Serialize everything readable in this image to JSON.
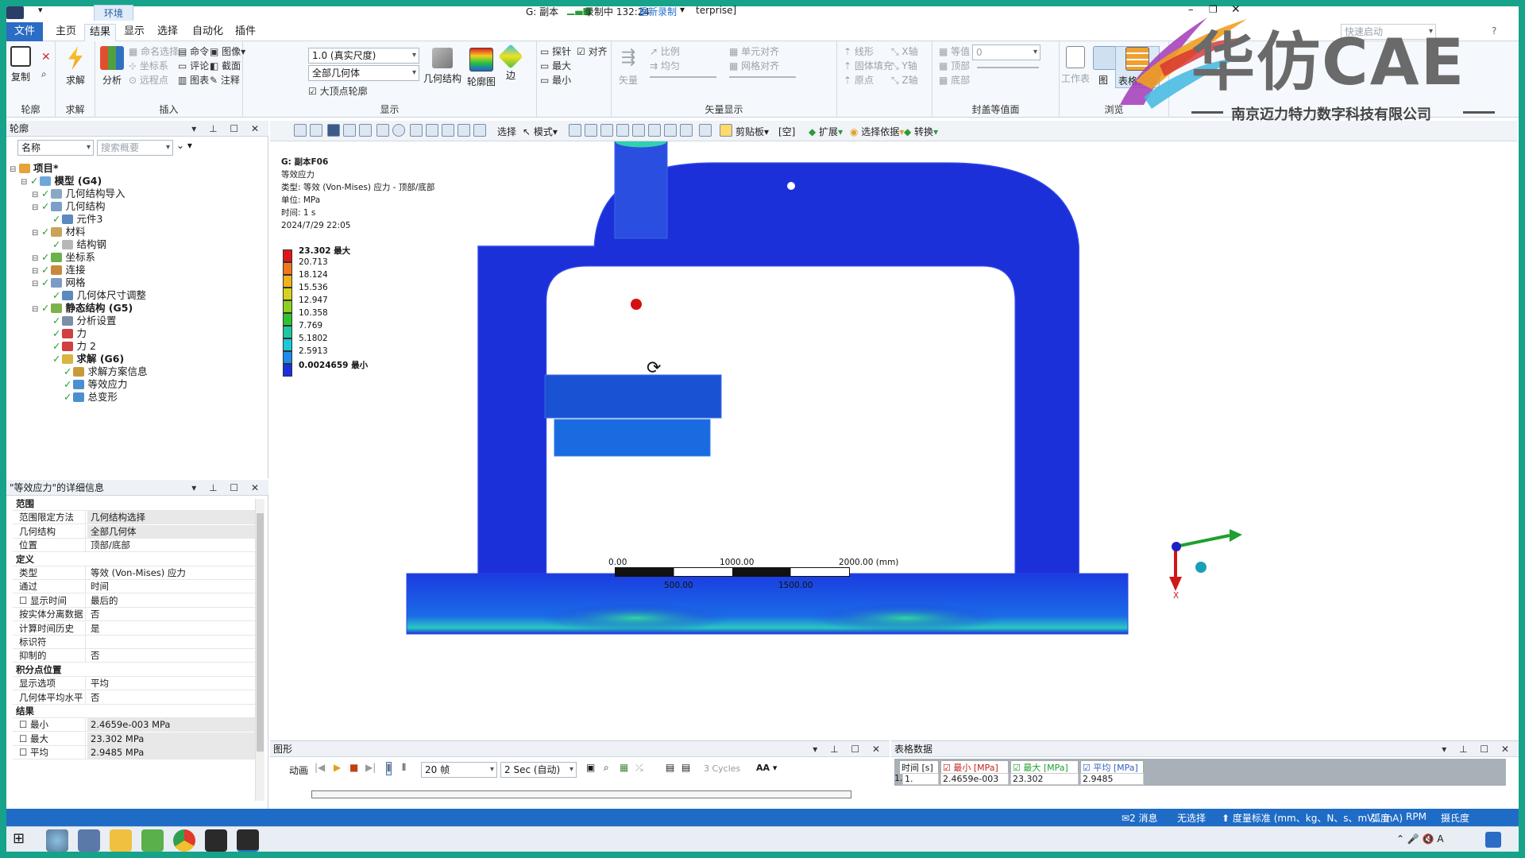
{
  "title": {
    "doc": "G: 副本",
    "recording": "录制中 132:24",
    "rerecord": "重新录制",
    "app_suffix": "terprise]",
    "context_tab": "环境"
  },
  "ribbon_tabs": [
    "文件",
    "主页",
    "结果",
    "显示",
    "选择",
    "自动化",
    "插件"
  ],
  "ribbon": {
    "groups": {
      "outline": "轮廓",
      "solve": "求解",
      "insert": "插入",
      "display": "显示",
      "vector_display": "矢量显示",
      "capped_iso": "封盖等值面",
      "browse": "浏览"
    },
    "buttons": {
      "copy": "复制",
      "solve": "求解",
      "analysis": "分析",
      "named_sel": "命名选择",
      "command": "命令",
      "image": "图像",
      "coord": "坐标系",
      "comment": "评论",
      "section": "截面",
      "remote_point": "远程点",
      "chart": "图表",
      "annotation": "注释",
      "geometry": "几何结构",
      "contour": "轮廓图",
      "edge": "边",
      "probe": "探针",
      "align": "对齐",
      "max": "最大",
      "min": "最小",
      "vector": "矢量",
      "ratio": "比例",
      "uniform": "均匀",
      "element_align": "单元对齐",
      "grid_align": "网格对齐",
      "line": "线形",
      "solid_fill": "固体填充",
      "origin": "原点",
      "x_axis": "X轴",
      "y_axis": "Y轴",
      "z_axis": "Z轴",
      "iso": "等值",
      "top": "顶部",
      "bottom": "底部",
      "worksheet": "工作表",
      "graph": "图",
      "tabular": "表格数据",
      "quick_launch": "快速启动"
    },
    "scale_value": "1.0 (真实尺度)",
    "geometry_value": "全部几何体",
    "iso_value": "0",
    "vertex_contour": "大顶点轮廓"
  },
  "toolbar2": {
    "select": "选择",
    "mode": "模式",
    "clipboard": "剪贴板",
    "empty": "[空]",
    "expand": "扩展",
    "select_by": "选择依据",
    "convert": "转换"
  },
  "outline_panel": {
    "title": "轮廓",
    "filter_label": "名称",
    "search_placeholder": "搜索概要",
    "tree": [
      {
        "label": "项目*",
        "level": 0,
        "bold": true,
        "color": "#e6a33a"
      },
      {
        "label": "模型 (G4)",
        "level": 1,
        "bold": true,
        "color": "#6fa8d8"
      },
      {
        "label": "几何结构导入",
        "level": 2,
        "bold": false,
        "color": "#8aa7c4"
      },
      {
        "label": "几何结构",
        "level": 2,
        "bold": false,
        "color": "#7aa0c8"
      },
      {
        "label": "元件3",
        "level": 3,
        "bold": false,
        "color": "#5a8ac0"
      },
      {
        "label": "材料",
        "level": 2,
        "bold": false,
        "color": "#c9a35a"
      },
      {
        "label": "结构钢",
        "level": 3,
        "bold": false,
        "color": "#b7b7b7"
      },
      {
        "label": "坐标系",
        "level": 2,
        "bold": false,
        "color": "#6ab04c"
      },
      {
        "label": "连接",
        "level": 2,
        "bold": false,
        "color": "#c88a3a"
      },
      {
        "label": "网格",
        "level": 2,
        "bold": false,
        "color": "#7a9cc4"
      },
      {
        "label": "几何体尺寸调整",
        "level": 3,
        "bold": false,
        "color": "#5a8ac0"
      },
      {
        "label": "静态结构 (G5)",
        "level": 2,
        "bold": true,
        "color": "#7bb34a"
      },
      {
        "label": "分析设置",
        "level": 3,
        "bold": false,
        "color": "#7c8fa8"
      },
      {
        "label": "力",
        "level": 3,
        "bold": false,
        "color": "#d04040"
      },
      {
        "label": "力 2",
        "level": 3,
        "bold": false,
        "color": "#d04040"
      },
      {
        "label": "求解 (G6)",
        "level": 3,
        "bold": true,
        "color": "#d8b440"
      },
      {
        "label": "求解方案信息",
        "level": 4,
        "bold": false,
        "color": "#c89b3a"
      },
      {
        "label": "等效应力",
        "level": 4,
        "bold": false,
        "color": "#4a90d0"
      },
      {
        "label": "总变形",
        "level": 4,
        "bold": false,
        "color": "#4a90d0"
      }
    ]
  },
  "details_panel": {
    "title": "\"等效应力\"的详细信息",
    "rows": [
      {
        "type": "section",
        "label": "范围"
      },
      {
        "k": "范围限定方法",
        "v": "几何结构选择",
        "sel": true
      },
      {
        "k": "几何结构",
        "v": "全部几何体",
        "sel": true
      },
      {
        "k": "位置",
        "v": "顶部/底部",
        "sel": false
      },
      {
        "type": "section",
        "label": "定义"
      },
      {
        "k": "类型",
        "v": "等效 (Von-Mises) 应力",
        "sel": false
      },
      {
        "k": "通过",
        "v": "时间",
        "sel": false
      },
      {
        "k": "显示时间",
        "v": "最后的",
        "sel": false,
        "box": true
      },
      {
        "k": "按实体分离数据",
        "v": "否",
        "sel": false
      },
      {
        "k": "计算时间历史",
        "v": "是",
        "sel": false
      },
      {
        "k": "标识符",
        "v": "",
        "sel": false
      },
      {
        "k": "抑制的",
        "v": "否",
        "sel": false
      },
      {
        "type": "section",
        "label": "积分点位置"
      },
      {
        "k": "显示选项",
        "v": "平均",
        "sel": false
      },
      {
        "k": "几何体平均水平",
        "v": "否",
        "sel": false
      },
      {
        "type": "section",
        "label": "结果"
      },
      {
        "k": "最小",
        "v": "2.4659e-003 MPa",
        "sel": true,
        "box": true
      },
      {
        "k": "最大",
        "v": "23.302 MPa",
        "sel": true,
        "box": true
      },
      {
        "k": "平均",
        "v": "2.9485 MPa",
        "sel": true,
        "box": true
      }
    ]
  },
  "viewport": {
    "info": [
      "G: 副本F06",
      "等效应力",
      "类型: 等效 (Von-Mises) 应力 - 顶部/底部",
      "单位: MPa",
      "时间: 1 s",
      "2024/7/29 22:05"
    ],
    "legend_colors": [
      "#e0161b",
      "#f07818",
      "#f0b21a",
      "#d7d31c",
      "#8ed01e",
      "#2fc42f",
      "#21c6a0",
      "#1ac8d8",
      "#1c8ce8",
      "#1b2fe0"
    ],
    "legend_labels": [
      "23.302 最大",
      "20.713",
      "18.124",
      "15.536",
      "12.947",
      "10.358",
      "7.769",
      "5.1802",
      "2.5913",
      "0.0024659 最小"
    ],
    "scale_top": [
      "0.00",
      "1000.00",
      "2000.00 (mm)"
    ],
    "scale_bottom": [
      "500.00",
      "1500.00"
    ],
    "axis_x": "X"
  },
  "graph_panel": {
    "title": "图形",
    "animate": "动画",
    "frames": "20 帧",
    "duration": "2 Sec (自动)",
    "cycles": "3 Cycles",
    "aa": "AA"
  },
  "tabular_panel": {
    "title": "表格数据",
    "headers": [
      "时间 [s]",
      "最小 [MPa]",
      "最大 [MPa]",
      "平均 [MPa]"
    ],
    "row": [
      "1.",
      "1.",
      "2.4659e-003",
      "23.302",
      "2.9485"
    ]
  },
  "statusbar": {
    "messages": "2 消息",
    "selection": "无选择",
    "units": "度量标准 (mm、kg、N、s、mV、mA)",
    "angle": "弧度",
    "rpm": "RPM",
    "temp": "摄氏度"
  },
  "watermark": {
    "brand": "华仿CAE",
    "company": "南京迈力特力数字科技有限公司"
  }
}
